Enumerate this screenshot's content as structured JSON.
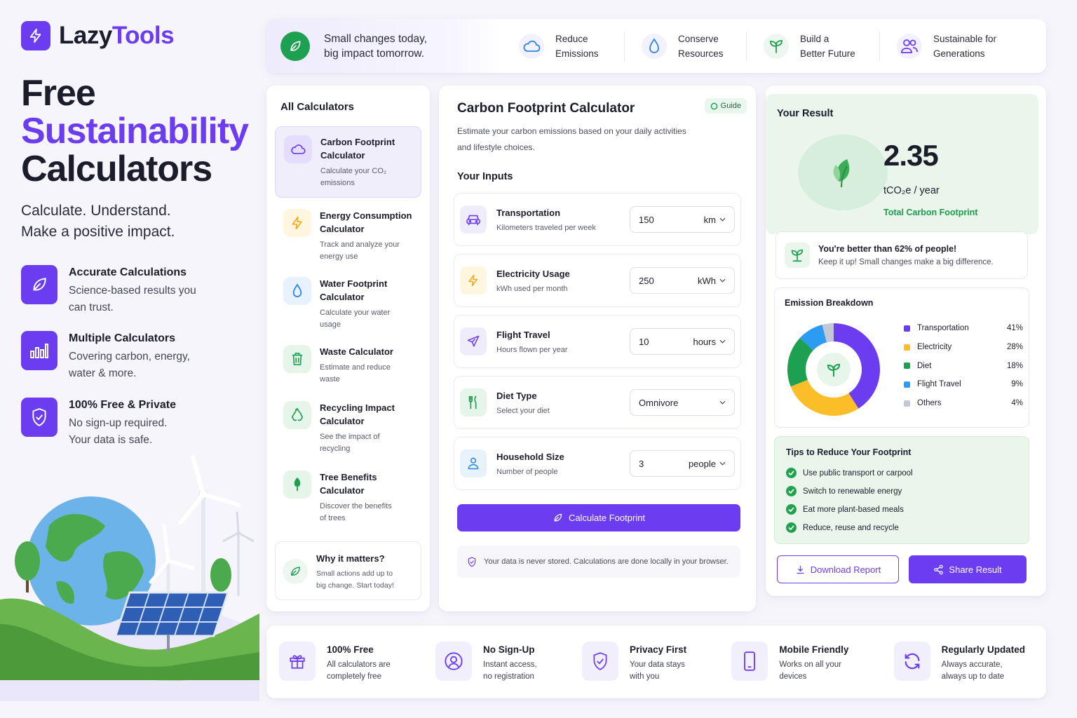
{
  "brand": {
    "name_part1": "Lazy",
    "name_part2": "Tools",
    "logo_icon": "bolt-icon"
  },
  "hero": {
    "title_line1": "Free",
    "title_line2": "Sustainability",
    "title_line3": "Calculators",
    "subtitle_line1": "Calculate. Understand.",
    "subtitle_line2": "Make a positive impact."
  },
  "features": [
    {
      "icon": "leaf-icon",
      "title": "Accurate Calculations",
      "desc_line1": "Science-based results you",
      "desc_line2": "can trust."
    },
    {
      "icon": "bar-chart-icon",
      "title": "Multiple Calculators",
      "desc_line1": "Covering carbon, energy,",
      "desc_line2": "water & more."
    },
    {
      "icon": "shield-check-icon",
      "title": "100% Free & Private",
      "desc_line1": "No sign-up required.",
      "desc_line2": "Your data is safe."
    }
  ],
  "banner": {
    "lead_line1": "Small changes today,",
    "lead_line2": "big impact tomorrow.",
    "items": [
      {
        "icon": "cloud-icon",
        "line1": "Reduce",
        "line2": "Emissions"
      },
      {
        "icon": "droplet-icon",
        "line1": "Conserve",
        "line2": "Resources"
      },
      {
        "icon": "sprout-icon",
        "line1": "Build a",
        "line2": "Better Future"
      },
      {
        "icon": "users-icon",
        "line1": "Sustainable for",
        "line2": "Generations"
      }
    ]
  },
  "sidebar": {
    "title": "All Calculators",
    "items": [
      {
        "name_line1": "Carbon Footprint",
        "name_line2": "Calculator",
        "desc_line1": "Calculate your CO₂",
        "desc_line2": "emissions",
        "icon": "cloud-icon",
        "active": true
      },
      {
        "name_line1": "Energy Consumption",
        "name_line2": "Calculator",
        "desc_line1": "Track and analyze your",
        "desc_line2": "energy use",
        "icon": "bolt-icon"
      },
      {
        "name_line1": "Water Footprint",
        "name_line2": "Calculator",
        "desc_line1": "Calculate your water",
        "desc_line2": "usage",
        "icon": "droplet-icon"
      },
      {
        "name_line1": "Waste Calculator",
        "name_line2": "",
        "desc_line1": "Estimate and reduce",
        "desc_line2": "waste",
        "icon": "trash-icon"
      },
      {
        "name_line1": "Recycling Impact",
        "name_line2": "Calculator",
        "desc_line1": "See the impact of",
        "desc_line2": "recycling",
        "icon": "recycle-icon"
      },
      {
        "name_line1": "Tree Benefits",
        "name_line2": "Calculator",
        "desc_line1": "Discover the benefits",
        "desc_line2": "of trees",
        "icon": "tree-icon"
      }
    ],
    "why": {
      "title": "Why it matters?",
      "line1": "Small actions add up to",
      "line2": "big change. Start today!"
    }
  },
  "calculator": {
    "title": "Carbon Footprint Calculator",
    "guide": "Guide",
    "desc_line1": "Estimate your carbon emissions based on your daily activities",
    "desc_line2": "and lifestyle choices.",
    "inputs_title": "Your Inputs",
    "inputs": [
      {
        "label": "Transportation",
        "hint": "Kilometers traveled per week",
        "value": "150",
        "unit": "km",
        "icon": "car-icon"
      },
      {
        "label": "Electricity Usage",
        "hint": "kWh used per month",
        "value": "250",
        "unit": "kWh",
        "icon": "bolt-icon"
      },
      {
        "label": "Flight Travel",
        "hint": "Hours flown per year",
        "value": "10",
        "unit": "hours",
        "icon": "plane-icon"
      },
      {
        "label": "Diet Type",
        "hint": "Select your diet",
        "value": "Omnivore",
        "unit": "",
        "icon": "fork-knife-icon"
      },
      {
        "label": "Household Size",
        "hint": "Number of people",
        "value": "3",
        "unit": "people",
        "icon": "user-icon"
      }
    ],
    "button": "Calculate Footprint",
    "note": "Your data is never stored. Calculations are done locally in your browser."
  },
  "result": {
    "label": "Your Result",
    "value": "2.35",
    "unit": "tCO₂e / year",
    "caption": "Total Carbon Footprint",
    "better_title": "You're better than 62% of people!",
    "better_sub": "Keep it up! Small changes make a big difference.",
    "breakdown_title": "Emission Breakdown",
    "tips_title": "Tips to Reduce Your Footprint",
    "tips": [
      "Use public transport or carpool",
      "Switch to renewable energy",
      "Eat more plant-based meals",
      "Reduce, reuse and recycle"
    ],
    "download": "Download Report",
    "share": "Share Result"
  },
  "chart_data": {
    "type": "pie",
    "title": "Emission Breakdown",
    "categories": [
      "Transportation",
      "Electricity",
      "Diet",
      "Flight Travel",
      "Others"
    ],
    "values": [
      41,
      28,
      18,
      9,
      4
    ],
    "labels": [
      "41%",
      "28%",
      "18%",
      "9%",
      "4%"
    ],
    "colors": [
      "#6b3cf0",
      "#fbbd28",
      "#1ea052",
      "#2b9cf2",
      "#c3c7d6"
    ],
    "legend": "right"
  },
  "bottom": [
    {
      "icon": "gift-icon",
      "title": "100% Free",
      "line1": "All calculators are",
      "line2": "completely free"
    },
    {
      "icon": "user-circle-icon",
      "title": "No Sign-Up",
      "line1": "Instant access,",
      "line2": "no registration"
    },
    {
      "icon": "shield-check-icon",
      "title": "Privacy First",
      "line1": "Your data stays",
      "line2": "with you"
    },
    {
      "icon": "phone-icon",
      "title": "Mobile Friendly",
      "line1": "Works on all your",
      "line2": "devices"
    },
    {
      "icon": "refresh-icon",
      "title": "Regularly Updated",
      "line1": "Always accurate,",
      "line2": "always up to date"
    }
  ]
}
